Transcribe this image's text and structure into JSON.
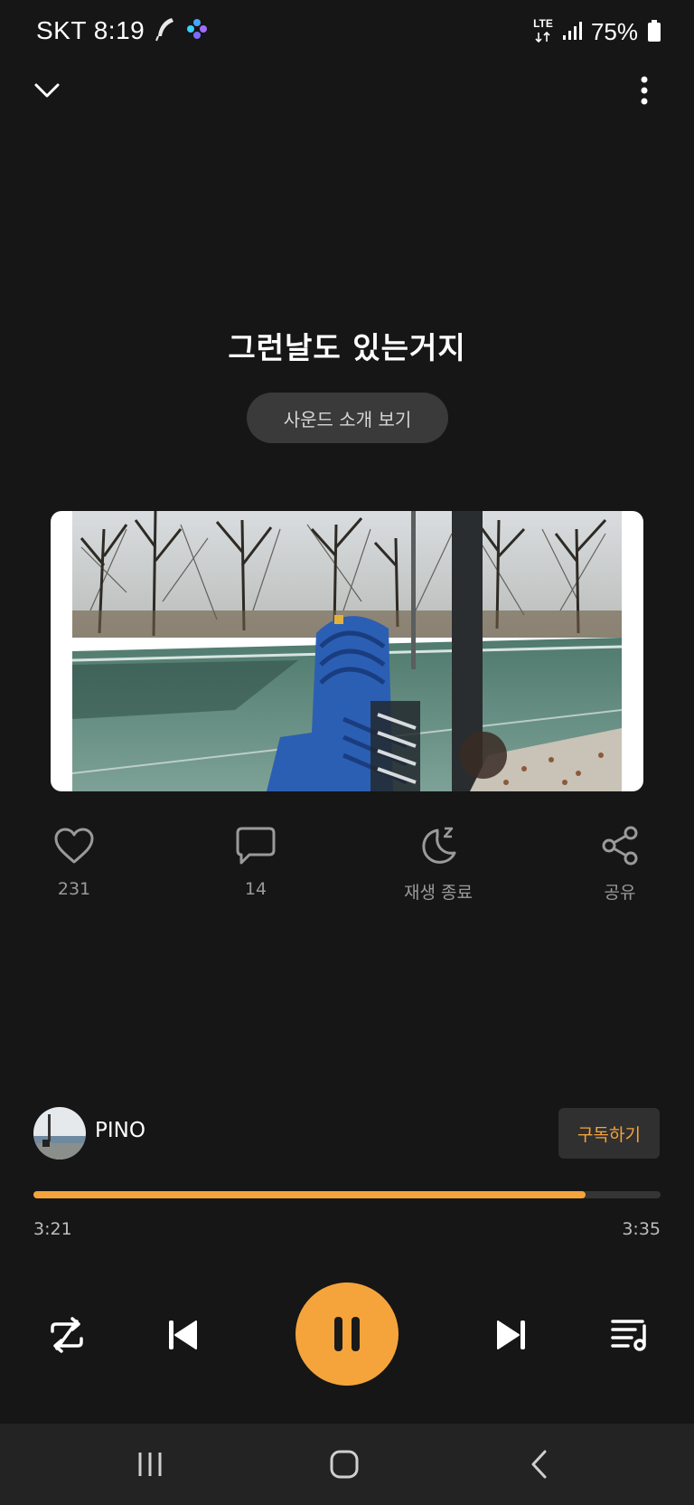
{
  "status_bar": {
    "carrier_time": "SKT 8:19",
    "network_top": "LTE",
    "battery": "75%"
  },
  "player": {
    "title": "그런날도 있는거지",
    "intro_button": "사운드 소개 보기",
    "actions": {
      "like_count": "231",
      "comment_count": "14",
      "sleep_timer_label": "재생 종료",
      "share_label": "공유"
    },
    "channel": {
      "name": "PINO",
      "subscribe_label": "구독하기"
    },
    "progress": {
      "current": "3:21",
      "total": "3:35",
      "fraction": 0.88
    }
  },
  "colors": {
    "accent": "#f5a43b",
    "background": "#161616",
    "chip": "#3a3a3a",
    "nav_bar": "#232323"
  },
  "icons": {
    "collapse": "chevron-down-icon",
    "more": "more-vertical-icon",
    "like": "heart-icon",
    "comment": "comment-icon",
    "sleep": "moon-z-icon",
    "share": "share-icon",
    "repeat": "repeat-off-icon",
    "previous": "skip-previous-icon",
    "pause": "pause-icon",
    "next": "skip-next-icon",
    "playlist": "playlist-icon"
  }
}
